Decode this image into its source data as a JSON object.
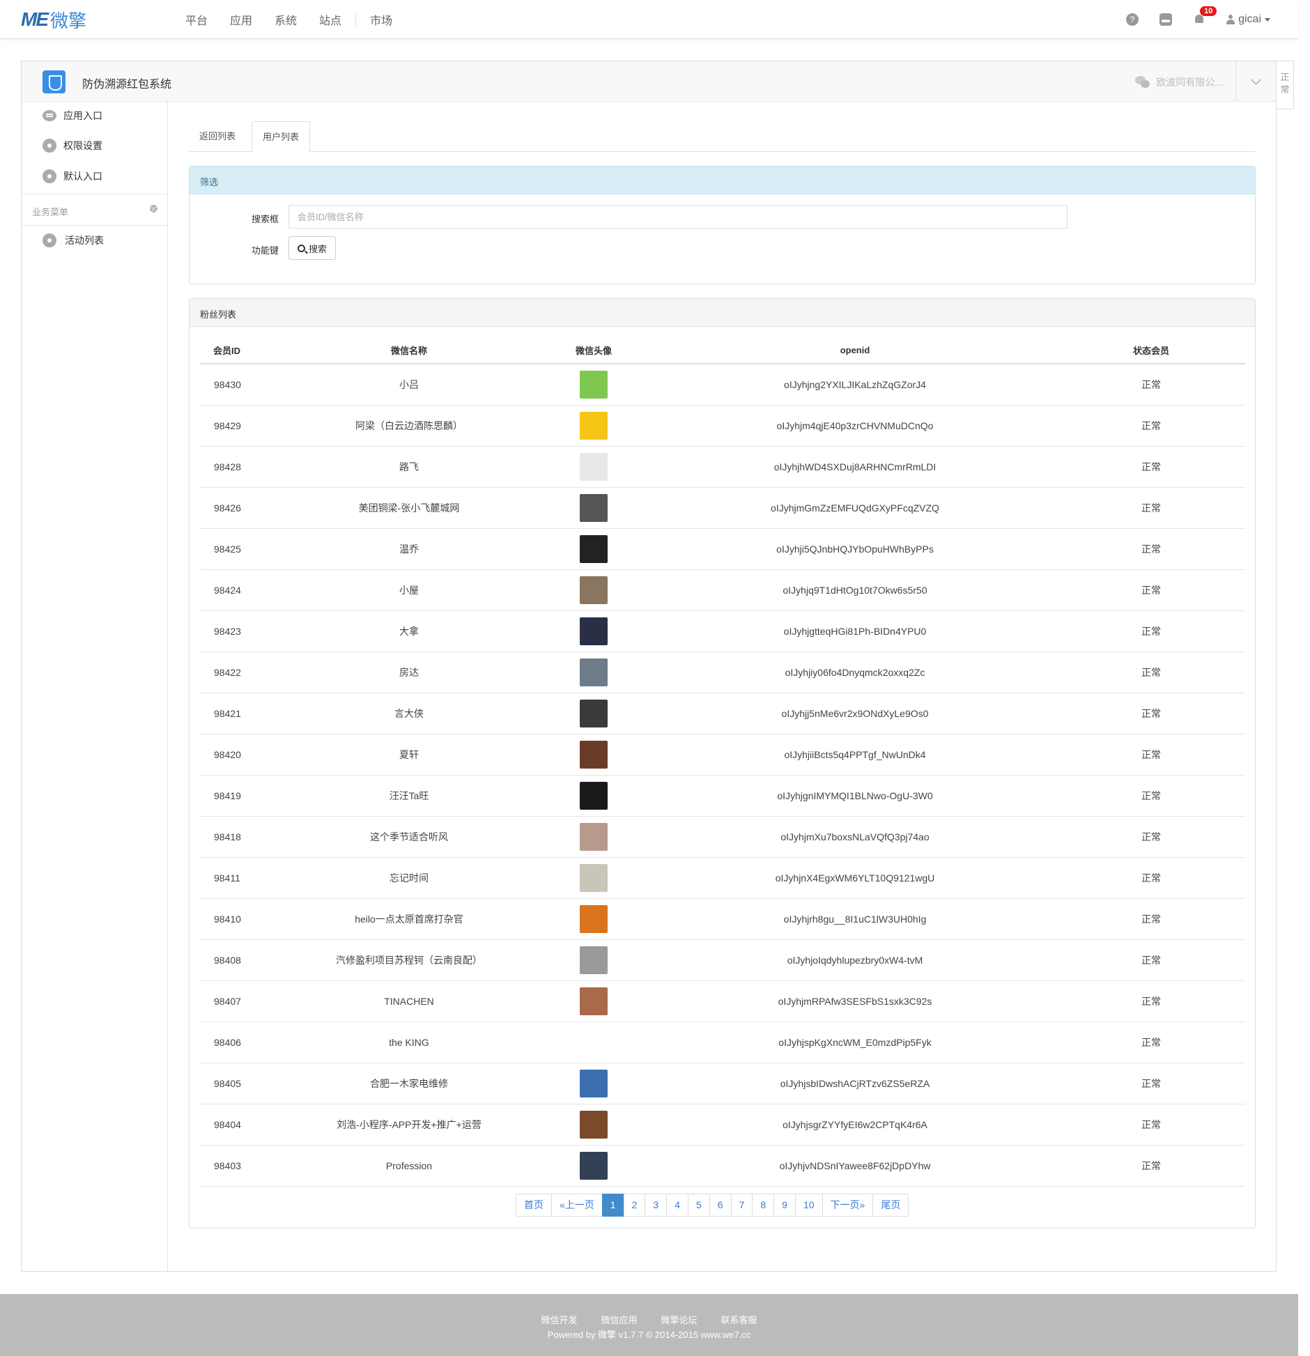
{
  "header": {
    "logo_mark": "ME",
    "logo_text": "微擎",
    "nav": [
      "平台",
      "应用",
      "系统",
      "站点",
      "市场"
    ],
    "notification_count": "10",
    "username": "gicai"
  },
  "app": {
    "title": "防伪溯源红包系统",
    "account": "欧波同有限公...",
    "side_tab": "正常"
  },
  "sidebar": {
    "items": [
      {
        "label": "应用入口",
        "icon": "chat-icon"
      },
      {
        "label": "权限设置",
        "icon": "gear-icon"
      },
      {
        "label": "默认入口",
        "icon": "gear-icon"
      }
    ],
    "group_title": "业务菜单",
    "group_items": [
      {
        "label": "活动列表",
        "icon": "gear-icon"
      }
    ]
  },
  "tabs": [
    "返回列表",
    "用户列表"
  ],
  "filter": {
    "title": "筛选",
    "search_label": "搜索框",
    "search_placeholder": "会员ID/微信名称",
    "func_label": "功能键",
    "search_button": "搜索"
  },
  "list": {
    "title": "粉丝列表",
    "columns": [
      "会员ID",
      "微信名称",
      "微信头像",
      "openid",
      "状态会员"
    ],
    "rows": [
      {
        "id": "98430",
        "name": "小吕",
        "openid": "oIJyhjng2YXILJIKaLzhZqGZorJ4",
        "status": "正常",
        "avatar_color": "#7ec850"
      },
      {
        "id": "98429",
        "name": "阿梁（白云边酒陈思麟）",
        "openid": "oIJyhjm4qjE40p3zrCHVNMuDCnQo",
        "status": "正常",
        "avatar_color": "#f5c518"
      },
      {
        "id": "98428",
        "name": "路飞",
        "openid": "oIJyhjhWD4SXDuj8ARHNCmrRmLDI",
        "status": "正常",
        "avatar_color": "#e8e8e8"
      },
      {
        "id": "98426",
        "name": "美团铜梁-张小飞麓城网",
        "openid": "oIJyhjmGmZzEMFUQdGXyPFcqZVZQ",
        "status": "正常",
        "avatar_color": "#555555"
      },
      {
        "id": "98425",
        "name": "温乔",
        "openid": "oIJyhji5QJnbHQJYbOpuHWhByPPs",
        "status": "正常",
        "avatar_color": "#222222"
      },
      {
        "id": "98424",
        "name": "小屋",
        "openid": "oIJyhjq9T1dHtOg10t7Okw6s5r50",
        "status": "正常",
        "avatar_color": "#8a7560"
      },
      {
        "id": "98423",
        "name": "大拿",
        "openid": "oIJyhjgtteqHGi81Ph-BIDn4YPU0",
        "status": "正常",
        "avatar_color": "#2a2f45"
      },
      {
        "id": "98422",
        "name": "房达",
        "openid": "oIJyhjiy06fo4Dnyqmck2oxxq2Zc",
        "status": "正常",
        "avatar_color": "#6d7c88"
      },
      {
        "id": "98421",
        "name": "言大侠",
        "openid": "oIJyhjj5nMe6vr2x9ONdXyLe9Os0",
        "status": "正常",
        "avatar_color": "#3a3a3a"
      },
      {
        "id": "98420",
        "name": "夏轩",
        "openid": "oIJyhjiiBcts5q4PPTgf_NwUnDk4",
        "status": "正常",
        "avatar_color": "#6b3b2a"
      },
      {
        "id": "98419",
        "name": "汪汪Ta旺",
        "openid": "oIJyhjgnIMYMQI1BLNwo-OgU-3W0",
        "status": "正常",
        "avatar_color": "#1a1a1a"
      },
      {
        "id": "98418",
        "name": "这个季节适合听风",
        "openid": "oIJyhjmXu7boxsNLaVQfQ3pj74ao",
        "status": "正常",
        "avatar_color": "#b89a8c"
      },
      {
        "id": "98411",
        "name": "忘记时间",
        "openid": "oIJyhjnX4EgxWM6YLT10Q9121wgU",
        "status": "正常",
        "avatar_color": "#c8c6b8"
      },
      {
        "id": "98410",
        "name": "heilo一点太原首席打杂官",
        "openid": "oIJyhjrh8gu__8I1uC1lW3UH0hIg",
        "status": "正常",
        "avatar_color": "#d9741f"
      },
      {
        "id": "98408",
        "name": "汽修盈利项目苏程钶（云南良配）",
        "openid": "oIJyhjoIqdyhlupezbry0xW4-tvM",
        "status": "正常",
        "avatar_color": "#9a9a9a"
      },
      {
        "id": "98407",
        "name": "TINACHEN",
        "openid": "oIJyhjmRPAfw3SESFbS1sxk3C92s",
        "status": "正常",
        "avatar_color": "#a86a4a"
      },
      {
        "id": "98406",
        "name": "the KING",
        "openid": "oIJyhjspKgXncWM_E0mzdPip5Fyk",
        "status": "正常",
        "avatar_color": ""
      },
      {
        "id": "98405",
        "name": "合肥一木家电维修",
        "openid": "oIJyhjsbIDwshACjRTzv6ZS5eRZA",
        "status": "正常",
        "avatar_color": "#3b6fb0"
      },
      {
        "id": "98404",
        "name": "刘浩-小程序-APP开发+推广+运营",
        "openid": "oIJyhjsgrZYYfyEI6w2CPTqK4r6A",
        "status": "正常",
        "avatar_color": "#7a4a2a"
      },
      {
        "id": "98403",
        "name": "Profession",
        "openid": "oIJyhjvNDSnIYawee8F62jDpDYhw",
        "status": "正常",
        "avatar_color": "#334055"
      }
    ]
  },
  "pagination": [
    "首页",
    "«上一页",
    "1",
    "2",
    "3",
    "4",
    "5",
    "6",
    "7",
    "8",
    "9",
    "10",
    "下一页»",
    "尾页"
  ],
  "pagination_active": "1",
  "footer": {
    "links": [
      "微信开发",
      "微信应用",
      "微擎论坛",
      "联系客服"
    ],
    "copyright": "Powered by 微擎 v1.7.7 © 2014-2015 www.we7.cc"
  }
}
